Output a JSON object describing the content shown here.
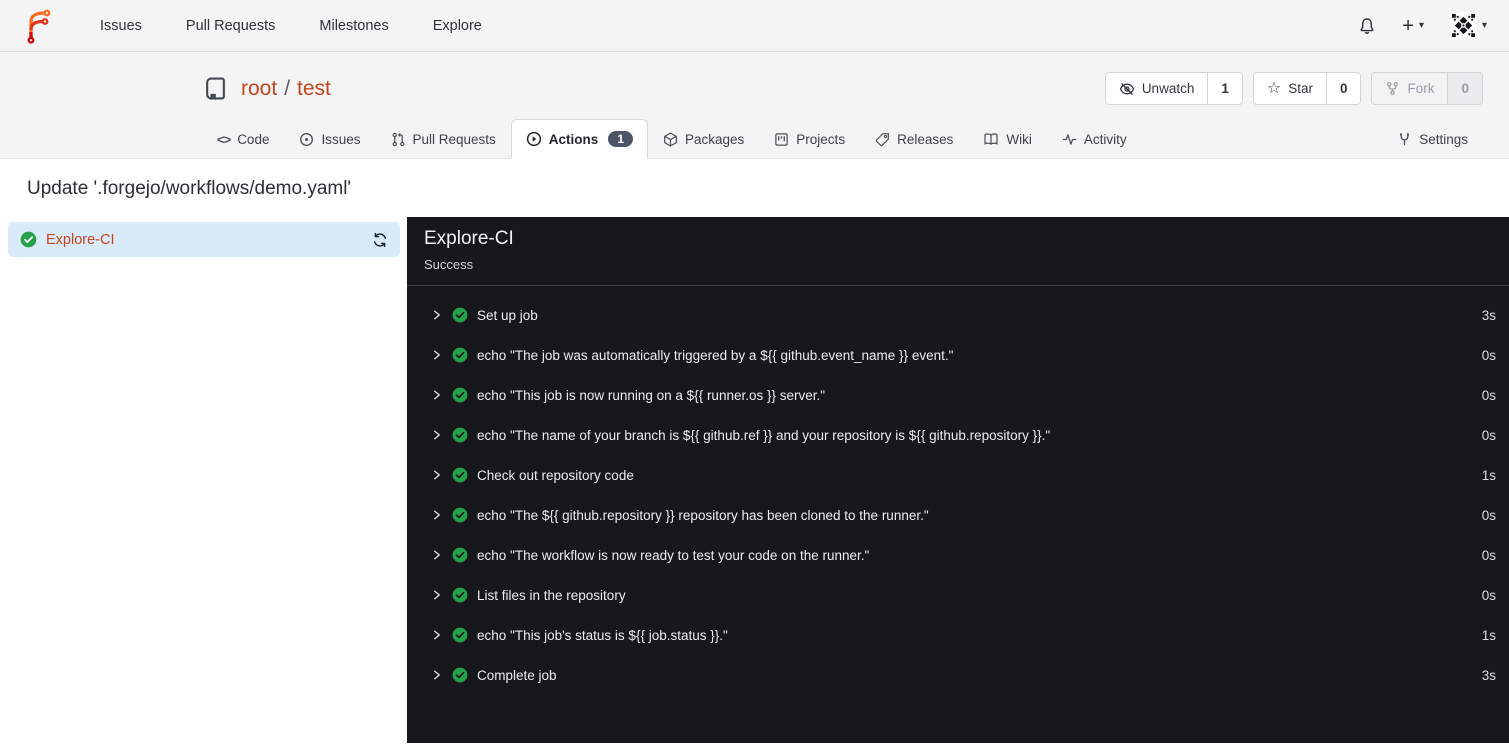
{
  "navbar": {
    "links": [
      {
        "label": "Issues"
      },
      {
        "label": "Pull Requests"
      },
      {
        "label": "Milestones"
      },
      {
        "label": "Explore"
      }
    ]
  },
  "repo": {
    "owner": "root",
    "separator": "/",
    "name": "test",
    "actions": {
      "unwatch": {
        "label": "Unwatch",
        "count": "1"
      },
      "star": {
        "label": "Star",
        "count": "0"
      },
      "fork": {
        "label": "Fork",
        "count": "0"
      }
    },
    "tabs": [
      {
        "label": "Code"
      },
      {
        "label": "Issues"
      },
      {
        "label": "Pull Requests"
      },
      {
        "label": "Actions",
        "badge": "1",
        "active": true
      },
      {
        "label": "Packages"
      },
      {
        "label": "Projects"
      },
      {
        "label": "Releases"
      },
      {
        "label": "Wiki"
      },
      {
        "label": "Activity"
      }
    ],
    "settings_tab": "Settings"
  },
  "run": {
    "title": "Update '.forgejo/workflows/demo.yaml'",
    "job": {
      "name": "Explore-CI",
      "status": "success"
    },
    "panel": {
      "title": "Explore-CI",
      "status_text": "Success"
    },
    "steps": [
      {
        "name": "Set up job",
        "duration": "3s"
      },
      {
        "name": "echo \"The job was automatically triggered by a ${{ github.event_name }} event.\"",
        "duration": "0s"
      },
      {
        "name": "echo \"This job is now running on a ${{ runner.os }} server.\"",
        "duration": "0s"
      },
      {
        "name": "echo \"The name of your branch is ${{ github.ref }} and your repository is ${{ github.repository }}.\"",
        "duration": "0s"
      },
      {
        "name": "Check out repository code",
        "duration": "1s"
      },
      {
        "name": "echo \"The ${{ github.repository }} repository has been cloned to the runner.\"",
        "duration": "0s"
      },
      {
        "name": "echo \"The workflow is now ready to test your code on the runner.\"",
        "duration": "0s"
      },
      {
        "name": "List files in the repository",
        "duration": "0s"
      },
      {
        "name": "echo \"This job's status is ${{ job.status }}.\"",
        "duration": "1s"
      },
      {
        "name": "Complete job",
        "duration": "3s"
      }
    ]
  },
  "icons": {
    "navbar": [
      "forgejo-logo",
      "bell-icon",
      "plus-icon",
      "caret-down-icon",
      "avatar"
    ],
    "repo": [
      "repo-book-icon",
      "eye-slash-icon",
      "star-icon",
      "fork-icon"
    ],
    "tabs": [
      "code-icon",
      "issue-icon",
      "pull-request-icon",
      "play-circle-icon",
      "package-icon",
      "project-icon",
      "tag-icon",
      "wiki-icon",
      "activity-icon",
      "tools-icon"
    ],
    "run": [
      "check-circle-icon",
      "sync-icon",
      "chevron-right-icon"
    ]
  },
  "colors": {
    "accent_link": "#c3461d",
    "success_green": "#26a148",
    "panel_bg": "#17181c",
    "selected_job_bg": "#d9eafa",
    "badge_bg": "#4b5565",
    "header_bg": "#f4f4f5"
  }
}
